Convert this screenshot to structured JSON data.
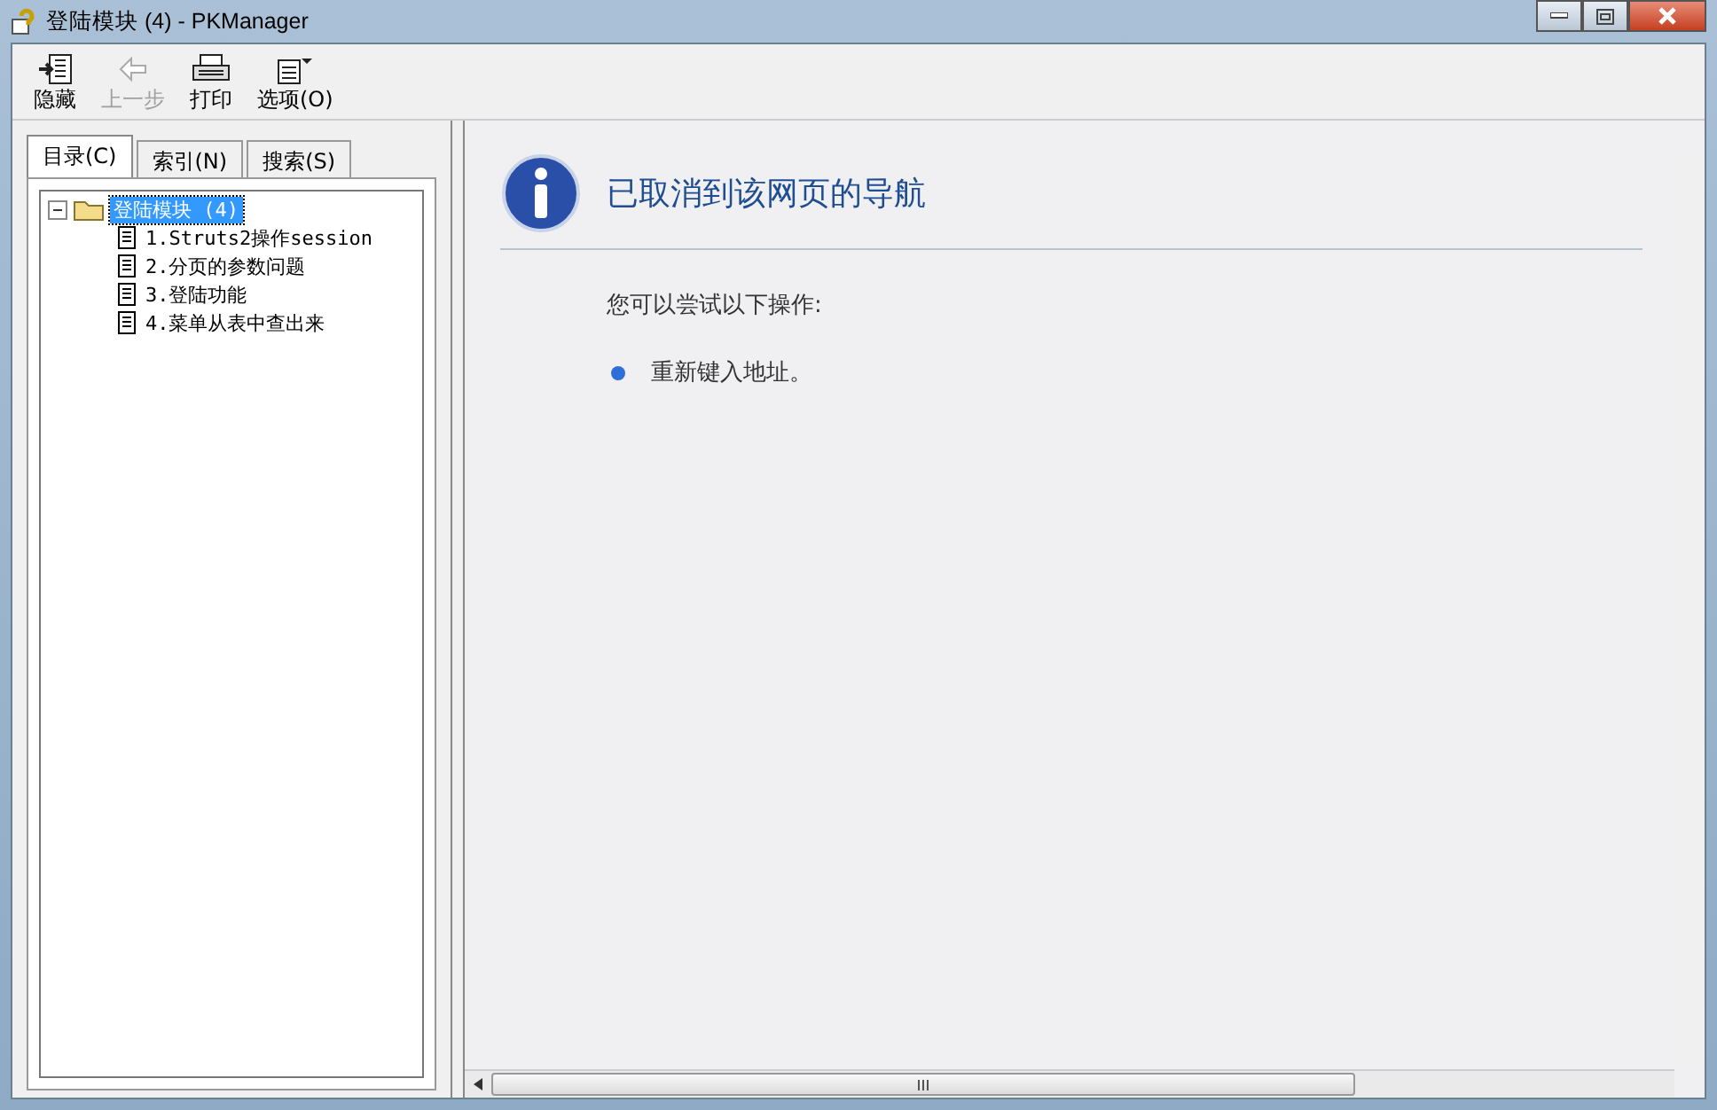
{
  "window": {
    "title": "登陆模块 (4) - PKManager"
  },
  "toolbar": [
    {
      "label": "隐藏",
      "kind": "hide",
      "disabled": false
    },
    {
      "label": "上一步",
      "kind": "back",
      "disabled": true
    },
    {
      "label": "打印",
      "kind": "print",
      "disabled": false
    },
    {
      "label": "选项(O)",
      "kind": "options",
      "disabled": false
    }
  ],
  "tabs": [
    {
      "label": "目录(C)",
      "selected": true
    },
    {
      "label": "索引(N)",
      "selected": false
    },
    {
      "label": "搜索(S)",
      "selected": false
    }
  ],
  "tree": [
    {
      "label": "登陆模块 (4)",
      "expanded": true,
      "selected": true,
      "children": [
        {
          "label": "1.Struts2操作session",
          "selected": false
        },
        {
          "label": "2.分页的参数问题",
          "selected": false
        },
        {
          "label": "3.登陆功能",
          "selected": false
        },
        {
          "label": "4.菜单从表中查出来",
          "selected": false
        }
      ]
    }
  ],
  "content": {
    "heading": "已取消到该网页的导航",
    "intro": "您可以尝试以下操作:",
    "items": [
      "重新键入地址。"
    ]
  }
}
